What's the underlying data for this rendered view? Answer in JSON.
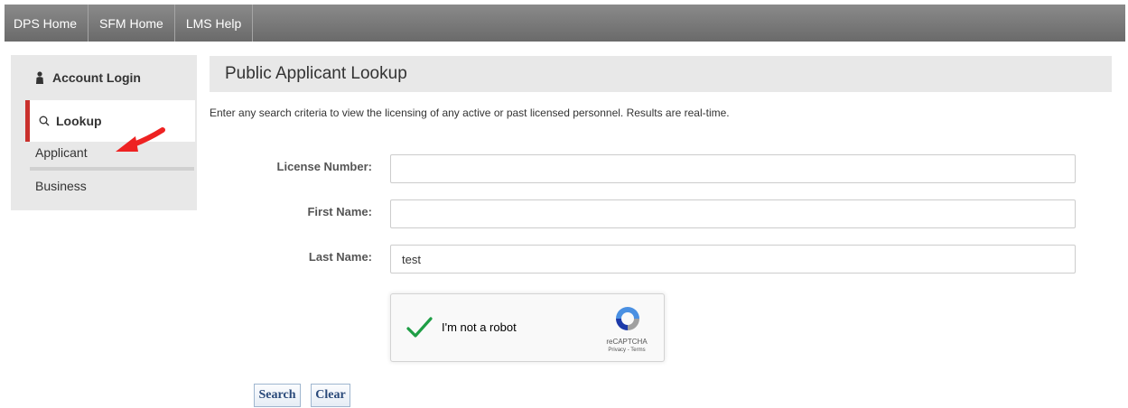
{
  "nav": {
    "items": [
      "DPS Home",
      "SFM Home",
      "LMS Help"
    ]
  },
  "sidebar": {
    "account_login": "Account Login",
    "lookup": "Lookup",
    "sub_items": [
      "Applicant",
      "Business"
    ],
    "accent_color": "#c9302c"
  },
  "main": {
    "title": "Public Applicant Lookup",
    "description": "Enter any search criteria to view the licensing of any active or past licensed personnel.  Results are real-time."
  },
  "form": {
    "license_number_label": "License Number:",
    "license_number_value": "",
    "first_name_label": "First Name:",
    "first_name_value": "",
    "last_name_label": "Last Name:",
    "last_name_value": "test"
  },
  "captcha": {
    "label": "I'm not a robot",
    "brand": "reCAPTCHA",
    "terms": "Privacy - Terms",
    "checked": true
  },
  "buttons": {
    "search": "Search",
    "clear": "Clear"
  }
}
